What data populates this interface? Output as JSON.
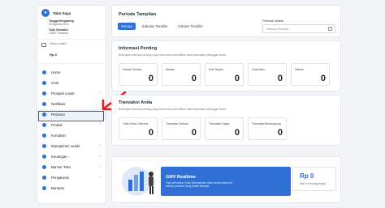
{
  "sidebar": {
    "store_name": "Toko Saya",
    "joined_label": "Tanggal Bergabung",
    "joined_date": "09 Agustus 2022",
    "trx_label": "Total Transaksi",
    "trx_value": "13520 Transaksi",
    "wallet_label": "Saldo e-wallet",
    "wallet_value": "Rp 0",
    "menu": [
      {
        "label": "Home",
        "icon": "home-icon",
        "chevron": false
      },
      {
        "label": "Chat",
        "icon": "chat-icon",
        "chevron": false
      },
      {
        "label": "Prospek Leads",
        "icon": "leads-icon",
        "chevron": true
      },
      {
        "label": "Notifikasi",
        "icon": "bell-icon",
        "chevron": false
      },
      {
        "label": "Pesanan",
        "icon": "order-icon",
        "chevron": false
      },
      {
        "label": "Produk",
        "icon": "product-icon",
        "chevron": true
      },
      {
        "label": "Komplain",
        "icon": "complaint-icon",
        "chevron": false
      },
      {
        "label": "Manajemen Leads",
        "icon": "manage-leads-icon",
        "chevron": true
      },
      {
        "label": "Keuangan",
        "icon": "finance-icon",
        "chevron": true
      },
      {
        "label": "Banner Toko",
        "icon": "banner-icon",
        "chevron": true
      },
      {
        "label": "Pengaturan",
        "icon": "settings-icon",
        "chevron": true
      },
      {
        "label": "Bantuan",
        "icon": "help-icon",
        "chevron": false
      }
    ]
  },
  "period": {
    "title": "Periode Tampilan",
    "tabs": [
      "Semua",
      "Sebulan Terakhir",
      "3 Bulan Terakhir"
    ],
    "waktu_label": "Periode Waktu",
    "waktu_placeholder": "Semua Periode"
  },
  "info": {
    "title": "Informasi Penting",
    "subtitle": "Beberapa informasi penting yang harus kamu perhatikan untuk kepuasan pelanggan Anda",
    "metrics": [
      {
        "label": "Ulasan Terbaru",
        "value": "0"
      },
      {
        "label": "Ulasan",
        "value": "0"
      },
      {
        "label": "Unit Terjual",
        "value": "0"
      },
      {
        "label": "Chat Baru",
        "value": "0"
      },
      {
        "label": "Ulasan",
        "value": "0"
      }
    ]
  },
  "transactions": {
    "title": "Transaksi Anda",
    "subtitle": "Beberapa informasi penting yang harus kamu perhatikan untuk kepuasan pelanggan Anda",
    "metrics": [
      {
        "label": "Total Order Diterima",
        "value": "0"
      },
      {
        "label": "Transaksi Selesai",
        "value": "0"
      },
      {
        "label": "Transaksi Gagal",
        "value": "0"
      },
      {
        "label": "Transaksi Berlangsung",
        "value": "0"
      }
    ]
  },
  "gmv": {
    "title": "GMV Realtime",
    "desc": "Total unit untuk Gross Merchandise Value untuk tokomu di seluruh pesanan yang sudah terbayar.",
    "value": "Rp 0",
    "sub": "Dari 0 unit yang terjual"
  },
  "colors": {
    "accent": "#2f6fd6",
    "highlight": "#e02020"
  }
}
